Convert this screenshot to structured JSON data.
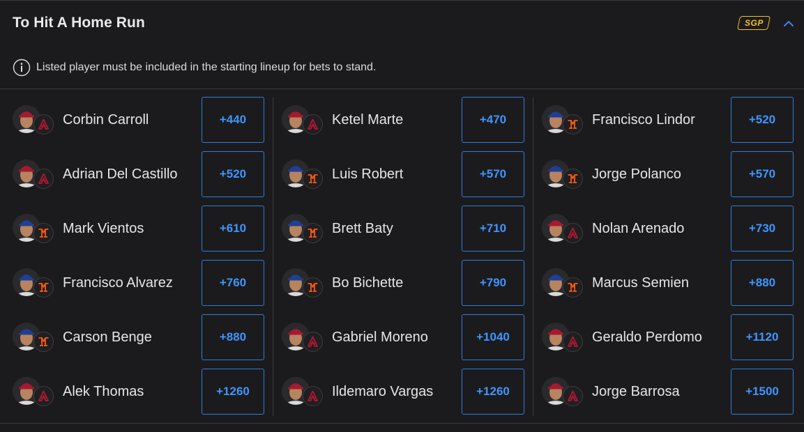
{
  "header": {
    "title": "To Hit A Home Run",
    "sgp_label": "SGP",
    "sgp_color": "#f2c230",
    "collapse_icon": "chevron-up-icon"
  },
  "notice": {
    "icon": "info-icon",
    "text": "Listed player must be included in the starting lineup for bets to stand."
  },
  "colors": {
    "odds": "#3f95ff",
    "odds_border": "#2f7ddd",
    "dbacks": "#a71930",
    "mets_cap": "#1f3f94",
    "mets_logo": "#ff5910"
  },
  "columns": [
    {
      "players": [
        {
          "name": "Corbin Carroll",
          "odds": "+440",
          "team": "dbacks"
        },
        {
          "name": "Adrian Del Castillo",
          "odds": "+520",
          "team": "dbacks"
        },
        {
          "name": "Mark Vientos",
          "odds": "+610",
          "team": "mets"
        },
        {
          "name": "Francisco Alvarez",
          "odds": "+760",
          "team": "mets"
        },
        {
          "name": "Carson Benge",
          "odds": "+880",
          "team": "mets"
        },
        {
          "name": "Alek Thomas",
          "odds": "+1260",
          "team": "dbacks"
        }
      ]
    },
    {
      "players": [
        {
          "name": "Ketel Marte",
          "odds": "+470",
          "team": "dbacks"
        },
        {
          "name": "Luis Robert",
          "odds": "+570",
          "team": "mets"
        },
        {
          "name": "Brett Baty",
          "odds": "+710",
          "team": "mets"
        },
        {
          "name": "Bo Bichette",
          "odds": "+790",
          "team": "mets"
        },
        {
          "name": "Gabriel Moreno",
          "odds": "+1040",
          "team": "dbacks"
        },
        {
          "name": "Ildemaro Vargas",
          "odds": "+1260",
          "team": "dbacks"
        }
      ]
    },
    {
      "players": [
        {
          "name": "Francisco Lindor",
          "odds": "+520",
          "team": "mets"
        },
        {
          "name": "Jorge Polanco",
          "odds": "+570",
          "team": "mets"
        },
        {
          "name": "Nolan Arenado",
          "odds": "+730",
          "team": "dbacks"
        },
        {
          "name": "Marcus Semien",
          "odds": "+880",
          "team": "mets"
        },
        {
          "name": "Geraldo Perdomo",
          "odds": "+1120",
          "team": "dbacks"
        },
        {
          "name": "Jorge Barrosa",
          "odds": "+1500",
          "team": "dbacks"
        }
      ]
    }
  ]
}
